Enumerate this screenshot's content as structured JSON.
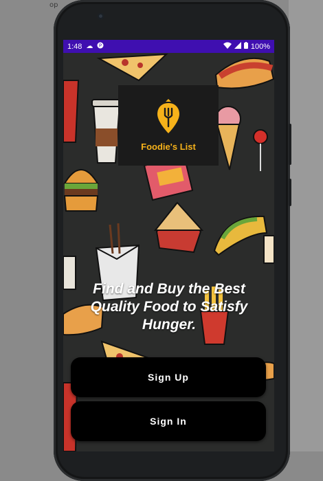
{
  "window_fragment": "op",
  "status_bar": {
    "time": "1:48",
    "battery": "100%",
    "icons": [
      "cloud-icon",
      "app-notification-icon",
      "wifi-icon",
      "signal-icon",
      "battery-icon"
    ]
  },
  "logo": {
    "text": "Foodie's List",
    "color": "#f6b21a",
    "icon": "location-pin-fork-icon"
  },
  "tagline": "Find and Buy the Best Quality Food to Satisfy Hunger.",
  "buttons": {
    "sign_up": "Sign Up",
    "sign_in": "Sign In"
  },
  "colors": {
    "status_bar": "#3f0fb0",
    "background": "#2b2c2b",
    "button": "#000000"
  }
}
